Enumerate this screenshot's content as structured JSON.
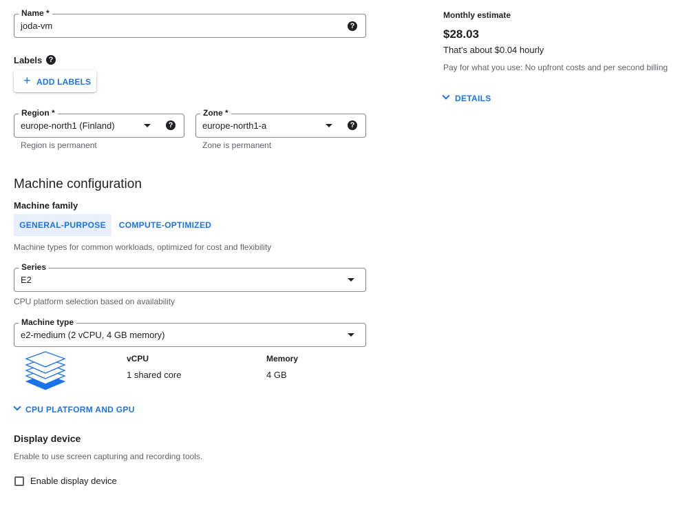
{
  "name_field": {
    "label": "Name *",
    "value": "joda-vm",
    "help_icon": "help-circle-icon"
  },
  "labels": {
    "title": "Labels",
    "add_button": "ADD LABELS",
    "help_icon": "help-circle-icon"
  },
  "region": {
    "label": "Region *",
    "value": "europe-north1 (Finland)",
    "hint": "Region is permanent"
  },
  "zone": {
    "label": "Zone *",
    "value": "europe-north1-a",
    "hint": "Zone is permanent"
  },
  "machine_configuration": {
    "title": "Machine configuration",
    "family_label": "Machine family",
    "tabs": [
      {
        "label": "GENERAL-PURPOSE",
        "active": true
      },
      {
        "label": "COMPUTE-OPTIMIZED",
        "active": false
      }
    ],
    "family_description": "Machine types for common workloads, optimized for cost and flexibility",
    "series": {
      "label": "Series",
      "value": "E2",
      "hint": "CPU platform selection based on availability"
    },
    "machine_type": {
      "label": "Machine type",
      "value": "e2-medium (2 vCPU, 4 GB memory)"
    },
    "specs": {
      "vcpu_label": "vCPU",
      "vcpu_value": "1 shared core",
      "memory_label": "Memory",
      "memory_value": "4 GB"
    },
    "cpu_platform_toggle": "CPU PLATFORM AND GPU"
  },
  "display_device": {
    "title": "Display device",
    "description": "Enable to use screen capturing and recording tools.",
    "checkbox_label": "Enable display device",
    "checked": false
  },
  "estimate": {
    "title": "Monthly estimate",
    "price": "$28.03",
    "hourly": "That's about $0.04 hourly",
    "note": "Pay for what you use: No upfront costs and per second billing",
    "details_toggle": "DETAILS"
  },
  "colors": {
    "accent": "#1a73e8",
    "tab_active_bg": "#e8f0fe",
    "text": "#202124",
    "muted": "#5f6368"
  }
}
